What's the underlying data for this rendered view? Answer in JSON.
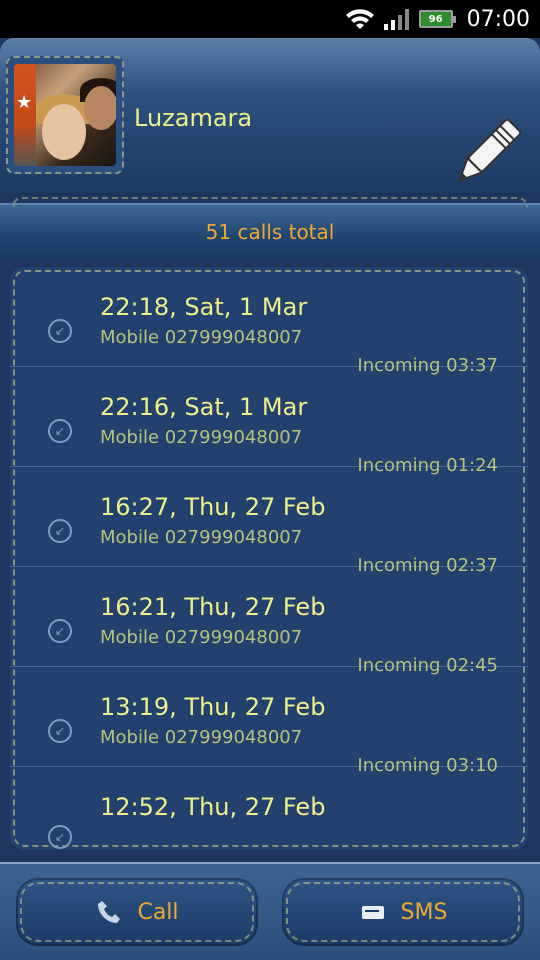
{
  "status": {
    "battery": "96",
    "time": "07:00"
  },
  "contact": {
    "name": "Luzamara"
  },
  "summary": {
    "total": "51 calls total"
  },
  "calls": [
    {
      "time": "22:18, Sat, 1 Mar",
      "number": "Mobile 027999048007",
      "duration": "Incoming 03:37"
    },
    {
      "time": "22:16, Sat, 1 Mar",
      "number": "Mobile 027999048007",
      "duration": "Incoming 01:24"
    },
    {
      "time": "16:27, Thu, 27 Feb",
      "number": "Mobile 027999048007",
      "duration": "Incoming 02:37"
    },
    {
      "time": "16:21, Thu, 27 Feb",
      "number": "Mobile 027999048007",
      "duration": "Incoming 02:45"
    },
    {
      "time": "13:19, Thu, 27 Feb",
      "number": "Mobile 027999048007",
      "duration": "Incoming 03:10"
    },
    {
      "time": "12:52, Thu, 27 Feb",
      "number": "",
      "duration": ""
    }
  ],
  "actions": {
    "call_label": "Call",
    "sms_label": "SMS"
  },
  "icons": {
    "wifi": "wifi-icon",
    "signal": "signal-icon",
    "battery": "battery-icon",
    "edit": "pencil-icon",
    "incoming": "incoming-call-icon",
    "call": "phone-icon",
    "sms": "message-icon"
  },
  "colors": {
    "accent_text": "#eef08a",
    "secondary_text": "#b8c27a",
    "button_text": "#f0a830",
    "denim": "#243f6d"
  }
}
